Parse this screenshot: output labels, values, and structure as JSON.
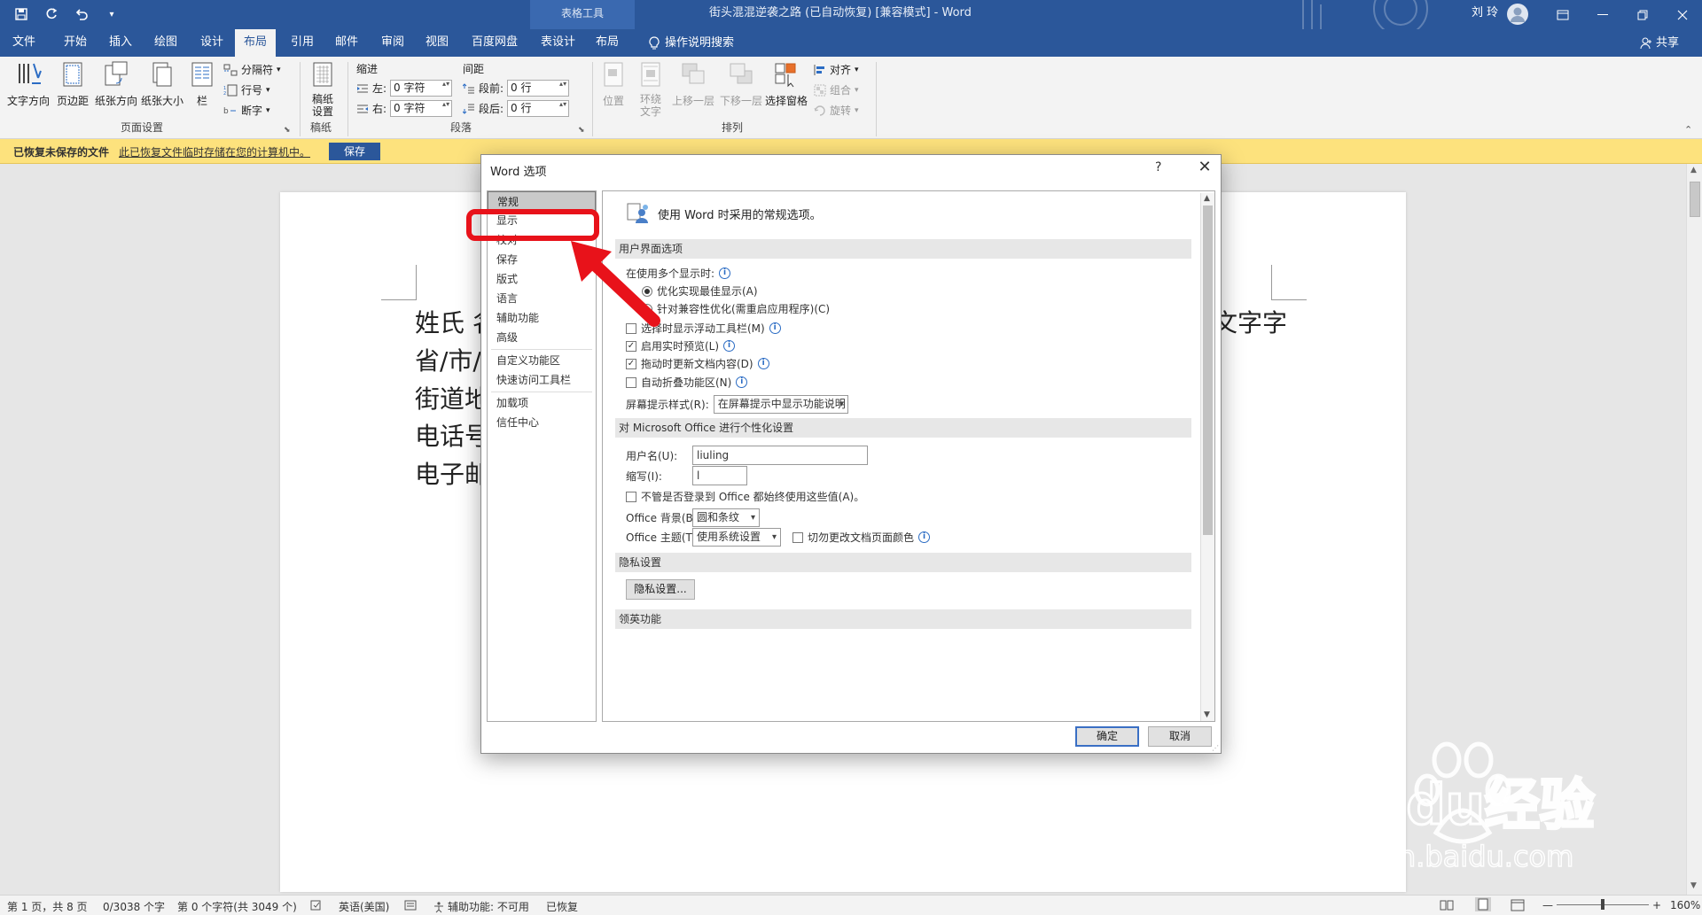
{
  "titlebar": {
    "contextual_tab": "表格工具",
    "doc_title": "街头混混逆袭之路 (已自动恢复) [兼容模式] - Word",
    "user": "刘 玲"
  },
  "tabs": [
    "文件",
    "开始",
    "插入",
    "绘图",
    "设计",
    "布局",
    "引用",
    "邮件",
    "审阅",
    "视图",
    "百度网盘",
    "表设计",
    "布局"
  ],
  "tell_me": "操作说明搜索",
  "share": "共享",
  "ribbon": {
    "page_setup": {
      "text_direction": "文字方向",
      "margins": "页边距",
      "orientation": "纸张方向",
      "size": "纸张大小",
      "columns": "栏",
      "breaks": "分隔符",
      "line_numbers": "行号",
      "hyphenation": "断字",
      "label": "页面设置"
    },
    "manuscript": {
      "btn": "稿纸设置",
      "label": "稿纸"
    },
    "paragraph": {
      "indent_label": "缩进",
      "spacing_label": "间距",
      "left": "左:",
      "right": "右:",
      "before": "段前:",
      "after": "段后:",
      "left_val": "0 字符",
      "right_val": "0 字符",
      "before_val": "0 行",
      "after_val": "0 行",
      "label": "段落"
    },
    "arrange": {
      "position": "位置",
      "wrap": "环绕文字",
      "bring_forward": "上移一层",
      "send_backward": "下移一层",
      "selection_pane": "选择窗格",
      "align": "对齐",
      "group": "组合",
      "rotate": "旋转",
      "label": "排列"
    }
  },
  "infobar": {
    "label": "已恢复未保存的文件",
    "message": "此已恢复文件临时存储在您的计算机中。",
    "save": "保存"
  },
  "document": {
    "lines": [
      "姓氏 名",
      "省/市/",
      "街道地",
      "电话号",
      "电子邮"
    ],
    "line1_tail": "文字字"
  },
  "dialog": {
    "title": "Word 选项",
    "help": "?",
    "close": "✕",
    "nav": [
      "常规",
      "显示",
      "校对",
      "保存",
      "版式",
      "语言",
      "辅助功能",
      "高级",
      "自定义功能区",
      "快速访问工具栏",
      "加载项",
      "信任中心"
    ],
    "intro": "使用 Word 时采用的常规选项。",
    "ui_section": "用户界面选项",
    "multi_display_label": "在使用多个显示时:",
    "radio_optimize": "优化实现最佳显示(A)",
    "radio_compat": "针对兼容性优化(需重启应用程序)(C)",
    "cb_mini_toolbar": "选择时显示浮动工具栏(M)",
    "cb_live_preview": "启用实时预览(L)",
    "cb_update_drag": "拖动时更新文档内容(D)",
    "cb_collapse_ribbon": "自动折叠功能区(N)",
    "screentip_label": "屏幕提示样式(R):",
    "screentip_value": "在屏幕提示中显示功能说明",
    "personalize_section": "对 Microsoft Office 进行个性化设置",
    "username_label": "用户名(U):",
    "username_value": "liuling",
    "initials_label": "缩写(I):",
    "initials_value": "l",
    "always_use": "不管是否登录到 Office 都始终使用这些值(A)。",
    "bg_label": "Office 背景(B):",
    "bg_value": "圆和条纹",
    "theme_label": "Office 主题(T):",
    "theme_value": "使用系统设置",
    "no_change_page_color": "切勿更改文档页面颜色",
    "privacy_section": "隐私设置",
    "privacy_btn": "隐私设置...",
    "linkedin_section": "领英功能",
    "ok": "确定",
    "cancel": "取消"
  },
  "statusbar": {
    "page": "第 1 页，共 8 页",
    "words": "0/3038 个字",
    "chars": "第 0 个字符(共 3049 个)",
    "language": "英语(美国)",
    "accessibility": "辅助功能: 不可用",
    "recovered": "已恢复",
    "zoom": "160%"
  },
  "watermark": {
    "brand": "Baidu经验",
    "url": "jingyan.baidu.com"
  },
  "colors": {
    "word_blue": "#2b579a",
    "annotation_red": "#e8121a",
    "infobar_yellow": "#fde27d"
  }
}
